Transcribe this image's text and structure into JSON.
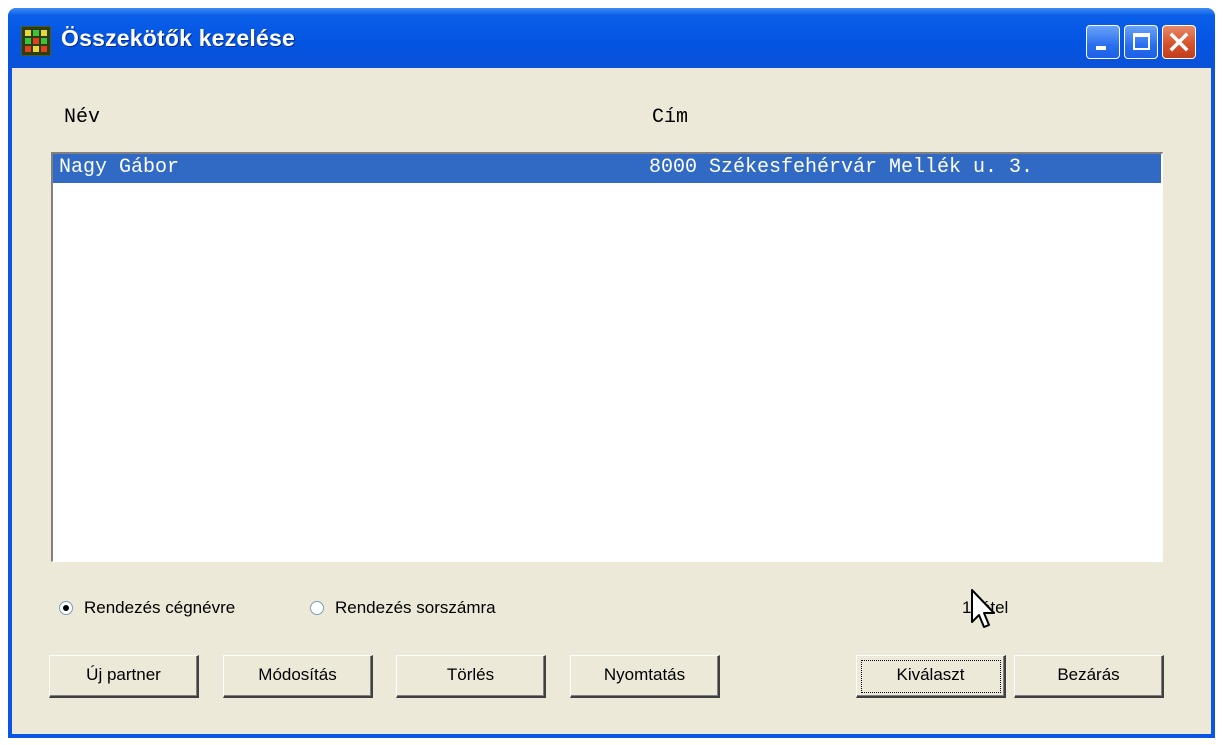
{
  "window": {
    "title": "Összekötők kezelése",
    "icon": "app-icon",
    "controls": [
      "minimize-icon",
      "maximize-icon",
      "close-icon"
    ]
  },
  "list": {
    "columns": [
      "Név",
      "Cím"
    ],
    "rows": [
      {
        "name": "Nagy Gábor",
        "address": "8000 Székesfehérvár Mellék u. 3.",
        "selected": true
      }
    ]
  },
  "sort": {
    "options": [
      {
        "label": "Rendezés cégnévre",
        "checked": true
      },
      {
        "label": "Rendezés sorszámra",
        "checked": false
      }
    ]
  },
  "count_label": "1 tétel",
  "buttons": {
    "new_partner": "Új partner",
    "modify": "Módosítás",
    "delete": "Törlés",
    "print": "Nyomtatás",
    "select": "Kiválaszt",
    "close": "Bezárás"
  },
  "colors": {
    "title_bar": "#0454e2",
    "selection": "#316ac5",
    "dialog_face": "#ece9d8",
    "close_button": "#d6522b"
  }
}
